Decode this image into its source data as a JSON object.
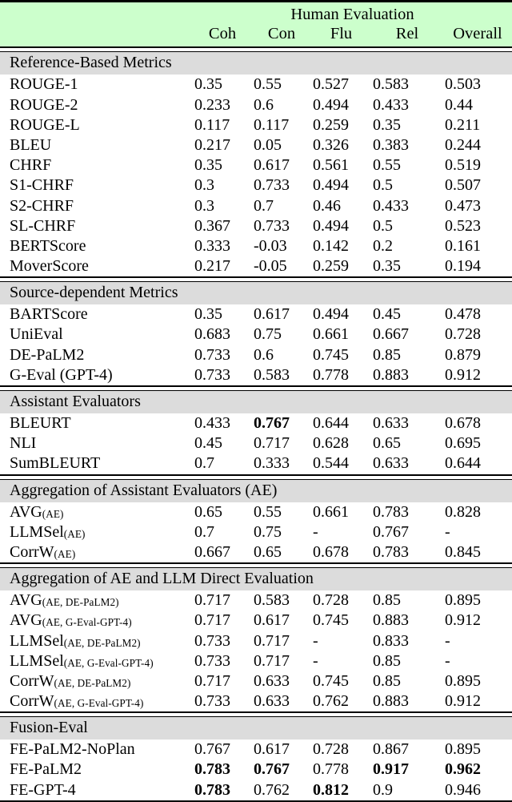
{
  "table": {
    "header": {
      "group_label": "Human Evaluation",
      "metric_col_label": "",
      "columns": [
        "Coh",
        "Con",
        "Flu",
        "Rel",
        "Overall"
      ]
    },
    "colors": {
      "header_band": "#ccffcc",
      "section_band": "#dcdcdc",
      "rule": "#000000",
      "text": "#000000"
    },
    "sections": [
      {
        "title": "Reference-Based Metrics",
        "rows": [
          {
            "name": "ROUGE-1",
            "sub": "",
            "values": [
              "0.35",
              "0.55",
              "0.527",
              "0.583",
              "0.503"
            ],
            "bold": [
              false,
              false,
              false,
              false,
              false
            ]
          },
          {
            "name": "ROUGE-2",
            "sub": "",
            "values": [
              "0.233",
              "0.6",
              "0.494",
              "0.433",
              "0.44"
            ],
            "bold": [
              false,
              false,
              false,
              false,
              false
            ]
          },
          {
            "name": "ROUGE-L",
            "sub": "",
            "values": [
              "0.117",
              "0.117",
              "0.259",
              "0.35",
              "0.211"
            ],
            "bold": [
              false,
              false,
              false,
              false,
              false
            ]
          },
          {
            "name": "BLEU",
            "sub": "",
            "values": [
              "0.217",
              "0.05",
              "0.326",
              "0.383",
              "0.244"
            ],
            "bold": [
              false,
              false,
              false,
              false,
              false
            ]
          },
          {
            "name": "CHRF",
            "sub": "",
            "values": [
              "0.35",
              "0.617",
              "0.561",
              "0.55",
              "0.519"
            ],
            "bold": [
              false,
              false,
              false,
              false,
              false
            ]
          },
          {
            "name": "S1-CHRF",
            "sub": "",
            "values": [
              "0.3",
              "0.733",
              "0.494",
              "0.5",
              "0.507"
            ],
            "bold": [
              false,
              false,
              false,
              false,
              false
            ]
          },
          {
            "name": "S2-CHRF",
            "sub": "",
            "values": [
              "0.3",
              "0.7",
              "0.46",
              "0.433",
              "0.473"
            ],
            "bold": [
              false,
              false,
              false,
              false,
              false
            ]
          },
          {
            "name": "SL-CHRF",
            "sub": "",
            "values": [
              "0.367",
              "0.733",
              "0.494",
              "0.5",
              "0.523"
            ],
            "bold": [
              false,
              false,
              false,
              false,
              false
            ]
          },
          {
            "name": "BERTScore",
            "sub": "",
            "values": [
              "0.333",
              "-0.03",
              "0.142",
              "0.2",
              "0.161"
            ],
            "bold": [
              false,
              false,
              false,
              false,
              false
            ]
          },
          {
            "name": "MoverScore",
            "sub": "",
            "values": [
              "0.217",
              "-0.05",
              "0.259",
              "0.35",
              "0.194"
            ],
            "bold": [
              false,
              false,
              false,
              false,
              false
            ]
          }
        ]
      },
      {
        "title": "Source-dependent Metrics",
        "rows": [
          {
            "name": "BARTScore",
            "sub": "",
            "values": [
              "0.35",
              "0.617",
              "0.494",
              "0.45",
              "0.478"
            ],
            "bold": [
              false,
              false,
              false,
              false,
              false
            ]
          },
          {
            "name": "UniEval",
            "sub": "",
            "values": [
              "0.683",
              "0.75",
              "0.661",
              "0.667",
              "0.728"
            ],
            "bold": [
              false,
              false,
              false,
              false,
              false
            ]
          },
          {
            "name": "DE-PaLM2",
            "sub": "",
            "values": [
              "0.733",
              "0.6",
              "0.745",
              "0.85",
              "0.879"
            ],
            "bold": [
              false,
              false,
              false,
              false,
              false
            ]
          },
          {
            "name": "G-Eval (GPT-4)",
            "sub": "",
            "values": [
              "0.733",
              "0.583",
              "0.778",
              "0.883",
              "0.912"
            ],
            "bold": [
              false,
              false,
              false,
              false,
              false
            ]
          }
        ]
      },
      {
        "title": "Assistant Evaluators",
        "rows": [
          {
            "name": "BLEURT",
            "sub": "",
            "values": [
              "0.433",
              "0.767",
              "0.644",
              "0.633",
              "0.678"
            ],
            "bold": [
              false,
              true,
              false,
              false,
              false
            ]
          },
          {
            "name": "NLI",
            "sub": "",
            "values": [
              "0.45",
              "0.717",
              "0.628",
              "0.65",
              "0.695"
            ],
            "bold": [
              false,
              false,
              false,
              false,
              false
            ]
          },
          {
            "name": "SumBLEURT",
            "sub": "",
            "values": [
              "0.7",
              "0.333",
              "0.544",
              "0.633",
              "0.644"
            ],
            "bold": [
              false,
              false,
              false,
              false,
              false
            ]
          }
        ]
      },
      {
        "title": "Aggregation of Assistant Evaluators (AE)",
        "rows": [
          {
            "name": "AVG",
            "sub": "(AE)",
            "values": [
              "0.65",
              "0.55",
              "0.661",
              "0.783",
              "0.828"
            ],
            "bold": [
              false,
              false,
              false,
              false,
              false
            ]
          },
          {
            "name": "LLMSel",
            "sub": "(AE)",
            "values": [
              "0.7",
              "0.75",
              "-",
              "0.767",
              "-"
            ],
            "bold": [
              false,
              false,
              false,
              false,
              false
            ]
          },
          {
            "name": "CorrW",
            "sub": "(AE)",
            "values": [
              "0.667",
              "0.65",
              "0.678",
              "0.783",
              "0.845"
            ],
            "bold": [
              false,
              false,
              false,
              false,
              false
            ]
          }
        ]
      },
      {
        "title": "Aggregation of AE and LLM Direct Evaluation",
        "rows": [
          {
            "name": "AVG",
            "sub": "(AE, DE-PaLM2)",
            "values": [
              "0.717",
              "0.583",
              "0.728",
              "0.85",
              "0.895"
            ],
            "bold": [
              false,
              false,
              false,
              false,
              false
            ]
          },
          {
            "name": "AVG",
            "sub": "(AE, G-Eval-GPT-4)",
            "values": [
              "0.717",
              "0.617",
              "0.745",
              "0.883",
              "0.912"
            ],
            "bold": [
              false,
              false,
              false,
              false,
              false
            ]
          },
          {
            "name": "LLMSel",
            "sub": "(AE, DE-PaLM2)",
            "values": [
              "0.733",
              "0.717",
              "-",
              "0.833",
              "-"
            ],
            "bold": [
              false,
              false,
              false,
              false,
              false
            ]
          },
          {
            "name": "LLMSel",
            "sub": "(AE, G-Eval-GPT-4)",
            "values": [
              "0.733",
              "0.717",
              "-",
              "0.85",
              "-"
            ],
            "bold": [
              false,
              false,
              false,
              false,
              false
            ]
          },
          {
            "name": "CorrW",
            "sub": "(AE, DE-PaLM2)",
            "values": [
              "0.717",
              "0.633",
              "0.745",
              "0.85",
              "0.895"
            ],
            "bold": [
              false,
              false,
              false,
              false,
              false
            ]
          },
          {
            "name": "CorrW",
            "sub": "(AE, G-Eval-GPT-4)",
            "values": [
              "0.733",
              "0.633",
              "0.762",
              "0.883",
              "0.912"
            ],
            "bold": [
              false,
              false,
              false,
              false,
              false
            ]
          }
        ]
      },
      {
        "title": "Fusion-Eval",
        "rows": [
          {
            "name": "FE-PaLM2-NoPlan",
            "sub": "",
            "values": [
              "0.767",
              "0.617",
              "0.728",
              "0.867",
              "0.895"
            ],
            "bold": [
              false,
              false,
              false,
              false,
              false
            ]
          },
          {
            "name": "FE-PaLM2",
            "sub": "",
            "values": [
              "0.783",
              "0.767",
              "0.778",
              "0.917",
              "0.962"
            ],
            "bold": [
              true,
              true,
              false,
              true,
              true
            ]
          },
          {
            "name": "FE-GPT-4",
            "sub": "",
            "values": [
              "0.783",
              "0.762",
              "0.812",
              "0.9",
              "0.946"
            ],
            "bold": [
              true,
              false,
              true,
              false,
              false
            ]
          }
        ]
      }
    ]
  },
  "chart_data": {
    "type": "table",
    "title": "Human Evaluation",
    "categories": [
      "Coh",
      "Con",
      "Flu",
      "Rel",
      "Overall"
    ],
    "series": [
      {
        "name": "ROUGE-1",
        "group": "Reference-Based Metrics",
        "values": [
          0.35,
          0.55,
          0.527,
          0.583,
          0.503
        ]
      },
      {
        "name": "ROUGE-2",
        "group": "Reference-Based Metrics",
        "values": [
          0.233,
          0.6,
          0.494,
          0.433,
          0.44
        ]
      },
      {
        "name": "ROUGE-L",
        "group": "Reference-Based Metrics",
        "values": [
          0.117,
          0.117,
          0.259,
          0.35,
          0.211
        ]
      },
      {
        "name": "BLEU",
        "group": "Reference-Based Metrics",
        "values": [
          0.217,
          0.05,
          0.326,
          0.383,
          0.244
        ]
      },
      {
        "name": "CHRF",
        "group": "Reference-Based Metrics",
        "values": [
          0.35,
          0.617,
          0.561,
          0.55,
          0.519
        ]
      },
      {
        "name": "S1-CHRF",
        "group": "Reference-Based Metrics",
        "values": [
          0.3,
          0.733,
          0.494,
          0.5,
          0.507
        ]
      },
      {
        "name": "S2-CHRF",
        "group": "Reference-Based Metrics",
        "values": [
          0.3,
          0.7,
          0.46,
          0.433,
          0.473
        ]
      },
      {
        "name": "SL-CHRF",
        "group": "Reference-Based Metrics",
        "values": [
          0.367,
          0.733,
          0.494,
          0.5,
          0.523
        ]
      },
      {
        "name": "BERTScore",
        "group": "Reference-Based Metrics",
        "values": [
          0.333,
          -0.03,
          0.142,
          0.2,
          0.161
        ]
      },
      {
        "name": "MoverScore",
        "group": "Reference-Based Metrics",
        "values": [
          0.217,
          -0.05,
          0.259,
          0.35,
          0.194
        ]
      },
      {
        "name": "BARTScore",
        "group": "Source-dependent Metrics",
        "values": [
          0.35,
          0.617,
          0.494,
          0.45,
          0.478
        ]
      },
      {
        "name": "UniEval",
        "group": "Source-dependent Metrics",
        "values": [
          0.683,
          0.75,
          0.661,
          0.667,
          0.728
        ]
      },
      {
        "name": "DE-PaLM2",
        "group": "Source-dependent Metrics",
        "values": [
          0.733,
          0.6,
          0.745,
          0.85,
          0.879
        ]
      },
      {
        "name": "G-Eval (GPT-4)",
        "group": "Source-dependent Metrics",
        "values": [
          0.733,
          0.583,
          0.778,
          0.883,
          0.912
        ]
      },
      {
        "name": "BLEURT",
        "group": "Assistant Evaluators",
        "values": [
          0.433,
          0.767,
          0.644,
          0.633,
          0.678
        ]
      },
      {
        "name": "NLI",
        "group": "Assistant Evaluators",
        "values": [
          0.45,
          0.717,
          0.628,
          0.65,
          0.695
        ]
      },
      {
        "name": "SumBLEURT",
        "group": "Assistant Evaluators",
        "values": [
          0.7,
          0.333,
          0.544,
          0.633,
          0.644
        ]
      },
      {
        "name": "AVG(AE)",
        "group": "Aggregation of Assistant Evaluators (AE)",
        "values": [
          0.65,
          0.55,
          0.661,
          0.783,
          0.828
        ]
      },
      {
        "name": "LLMSel(AE)",
        "group": "Aggregation of Assistant Evaluators (AE)",
        "values": [
          0.7,
          0.75,
          null,
          0.767,
          null
        ]
      },
      {
        "name": "CorrW(AE)",
        "group": "Aggregation of Assistant Evaluators (AE)",
        "values": [
          0.667,
          0.65,
          0.678,
          0.783,
          0.845
        ]
      },
      {
        "name": "AVG(AE, DE-PaLM2)",
        "group": "Aggregation of AE and LLM Direct Evaluation",
        "values": [
          0.717,
          0.583,
          0.728,
          0.85,
          0.895
        ]
      },
      {
        "name": "AVG(AE, G-Eval-GPT-4)",
        "group": "Aggregation of AE and LLM Direct Evaluation",
        "values": [
          0.717,
          0.617,
          0.745,
          0.883,
          0.912
        ]
      },
      {
        "name": "LLMSel(AE, DE-PaLM2)",
        "group": "Aggregation of AE and LLM Direct Evaluation",
        "values": [
          0.733,
          0.717,
          null,
          0.833,
          null
        ]
      },
      {
        "name": "LLMSel(AE, G-Eval-GPT-4)",
        "group": "Aggregation of AE and LLM Direct Evaluation",
        "values": [
          0.733,
          0.717,
          null,
          0.85,
          null
        ]
      },
      {
        "name": "CorrW(AE, DE-PaLM2)",
        "group": "Aggregation of AE and LLM Direct Evaluation",
        "values": [
          0.717,
          0.633,
          0.745,
          0.85,
          0.895
        ]
      },
      {
        "name": "CorrW(AE, G-Eval-GPT-4)",
        "group": "Aggregation of AE and LLM Direct Evaluation",
        "values": [
          0.733,
          0.633,
          0.762,
          0.883,
          0.912
        ]
      },
      {
        "name": "FE-PaLM2-NoPlan",
        "group": "Fusion-Eval",
        "values": [
          0.767,
          0.617,
          0.728,
          0.867,
          0.895
        ]
      },
      {
        "name": "FE-PaLM2",
        "group": "Fusion-Eval",
        "values": [
          0.783,
          0.767,
          0.778,
          0.917,
          0.962
        ]
      },
      {
        "name": "FE-GPT-4",
        "group": "Fusion-Eval",
        "values": [
          0.783,
          0.762,
          0.812,
          0.9,
          0.946
        ]
      }
    ],
    "xlabel": "",
    "ylabel": "",
    "grid": false,
    "legend": "none"
  }
}
